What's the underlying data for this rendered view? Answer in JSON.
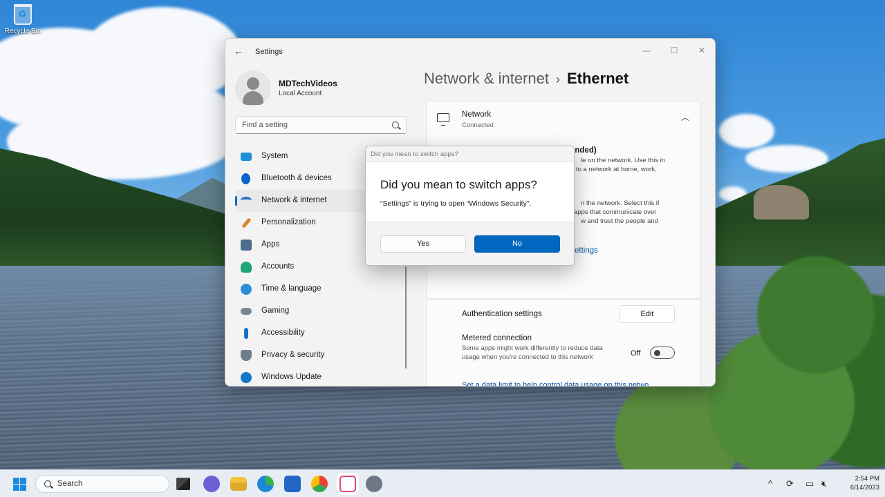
{
  "desktop": {
    "icons": [
      {
        "label": "Recycle Bin"
      }
    ]
  },
  "settings": {
    "title": "Settings",
    "user": {
      "name": "MDTechVideos",
      "account_type": "Local Account"
    },
    "search_placeholder": "Find a setting",
    "nav": [
      {
        "label": "System",
        "icon": "monitor-icon",
        "color": "#1e90d6"
      },
      {
        "label": "Bluetooth & devices",
        "icon": "bluetooth-icon",
        "color": "#0a64c8"
      },
      {
        "label": "Network & internet",
        "icon": "wifi-icon",
        "color": "#1f73c9",
        "active": true
      },
      {
        "label": "Personalization",
        "icon": "brush-icon",
        "color": "#d9822b"
      },
      {
        "label": "Apps",
        "icon": "apps-icon",
        "color": "#4d6b8a"
      },
      {
        "label": "Accounts",
        "icon": "person-icon",
        "color": "#20a67a"
      },
      {
        "label": "Time & language",
        "icon": "globe-clock-icon",
        "color": "#2c8fd6"
      },
      {
        "label": "Gaming",
        "icon": "gamepad-icon",
        "color": "#7a8593"
      },
      {
        "label": "Accessibility",
        "icon": "accessibility-icon",
        "color": "#1a6fc4"
      },
      {
        "label": "Privacy & security",
        "icon": "shield-icon",
        "color": "#6f7c8a"
      },
      {
        "label": "Windows Update",
        "icon": "update-icon",
        "color": "#1475c9"
      }
    ],
    "breadcrumb": {
      "parent": "Network & internet",
      "separator": "›",
      "current": "Ethernet"
    },
    "network_card": {
      "title": "Network",
      "status": "Connected"
    },
    "profile_fragments": {
      "recommended": "ended)",
      "public_line1": "le on the network. Use this in",
      "public_line2": "d to a network at home, work,",
      "private_line1": "n the network. Select this if",
      "private_line2": "apps that communicate over",
      "private_line3": "w and trust the people and"
    },
    "firewall_link": "Configure firewall and security settings",
    "authentication": {
      "label": "Authentication settings",
      "button": "Edit"
    },
    "metered": {
      "label": "Metered connection",
      "description": "Some apps might work differently to reduce data usage when you're connected to this network",
      "state": "Off"
    },
    "data_limit_link": "Set a data limit to help control data usage on this netwo"
  },
  "dialog": {
    "titlebar": "Did you mean to switch apps?",
    "heading": "Did you mean to switch apps?",
    "message": "“Settings” is trying to open “Windows Security”.",
    "yes_label": "Yes",
    "no_label": "No",
    "accent": "#0067c0"
  },
  "taskbar": {
    "search_label": "Search",
    "apps": [
      "task-view-icon",
      "chat-icon",
      "file-explorer-icon",
      "edge-icon",
      "store-icon",
      "chrome-icon",
      "snipping-tool-icon",
      "settings-gear-icon"
    ],
    "time": "2:54 PM",
    "date": "6/14/2023"
  }
}
